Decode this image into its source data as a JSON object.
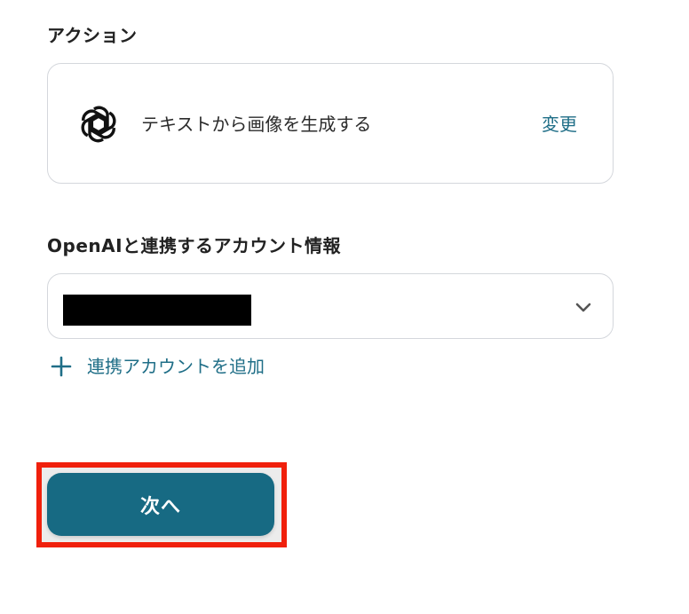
{
  "action_section": {
    "label": "アクション",
    "icon": "openai-logo-icon",
    "action_name": "テキストから画像を生成する",
    "change_label": "変更"
  },
  "account_section": {
    "label": "OpenAIと連携するアカウント情報",
    "selected_value_redacted": true,
    "add_account_label": "連携アカウントを追加"
  },
  "footer": {
    "next_label": "次へ"
  },
  "colors": {
    "accent": "#176a83",
    "link": "#1f6e87",
    "highlight": "#f0200c",
    "border": "#d4d7dc"
  }
}
